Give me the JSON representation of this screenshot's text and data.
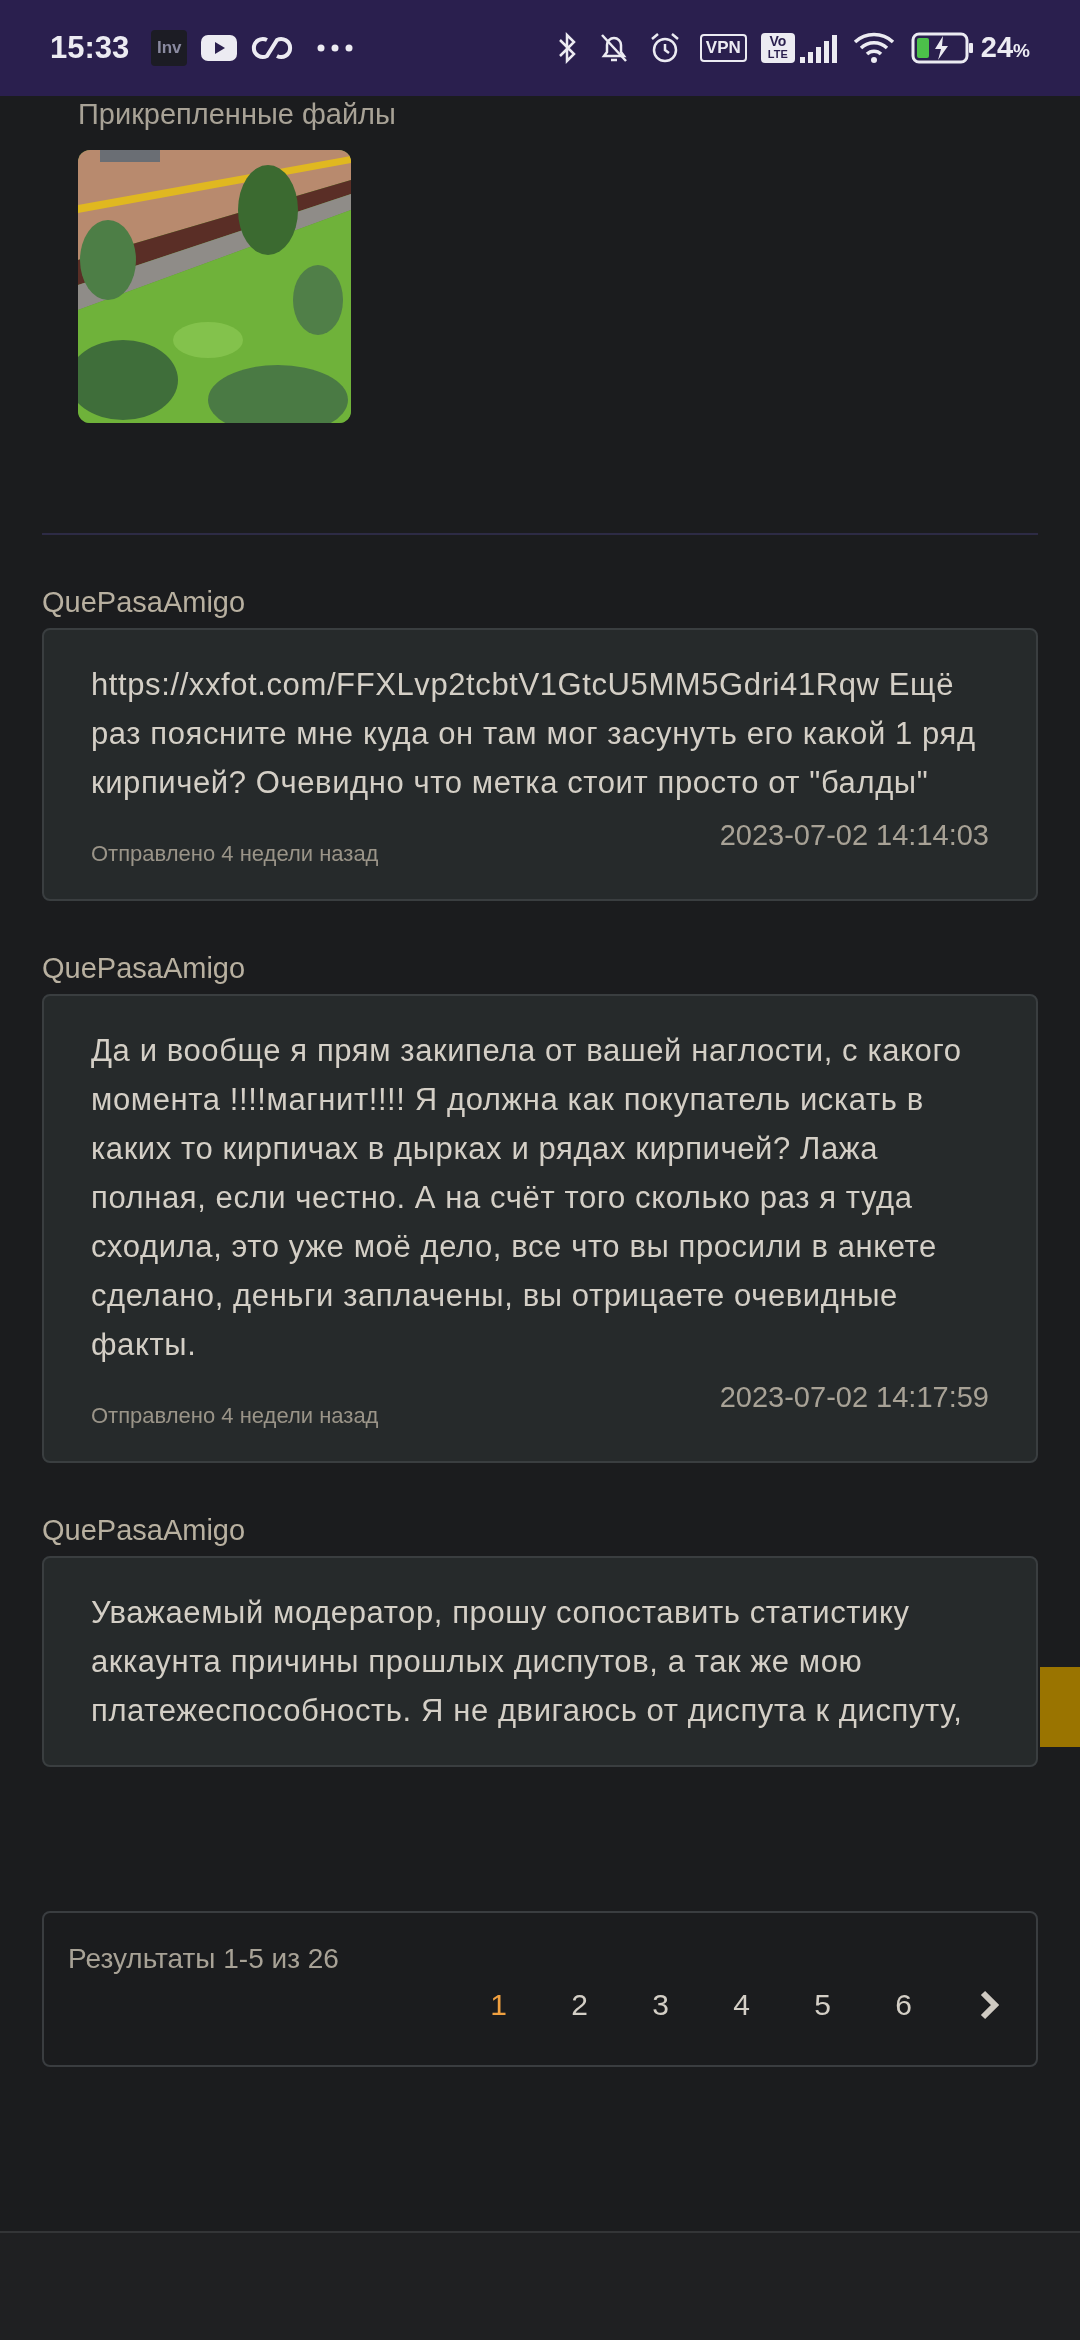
{
  "status_bar": {
    "time": "15:33",
    "app_badge": "Inv",
    "vpn": "VPN",
    "volte_top": "Vo",
    "volte_bottom": "LTE",
    "battery": "24",
    "battery_unit": "%"
  },
  "attachments": {
    "title": "Прикрепленные файлы"
  },
  "comments": [
    {
      "author": "QuePasaAmigo",
      "text": "https://xxfot.com/FFXLvp2tcbtV1GtcU5MM5Gdri41Rqw Ещё раз поясните мне куда он там мог засунуть его какой 1 ряд кирпичей? Очевидно что метка стоит просто от \"балды\"",
      "sent": "Отправлено 4 недели назад",
      "timestamp": "2023-07-02 14:14:03"
    },
    {
      "author": "QuePasaAmigo",
      "text": "Да и вообще я прям закипела от вашей наглости, с какого момента !!!!магнит!!!! Я должна как покупатель искать в каких то кирпичах в дырках и рядах кирпичей? Лажа полная, если честно. А на счёт того сколько раз я туда сходила, это уже моё дело, все что вы просили в анкете сделано, деньги заплачены, вы отрицаете очевидные факты.",
      "sent": "Отправлено 4 недели назад",
      "timestamp": "2023-07-02 14:17:59"
    },
    {
      "author": "QuePasaAmigo",
      "text": "Уважаемый модератор, прошу сопоставить статистику аккаунта причины прошлых диспутов, а так же мою платежеспособность. Я не двигаюсь от диспута к диспуту,"
    }
  ],
  "pagination": {
    "summary": "Результаты 1-5 из 26",
    "pages": [
      {
        "label": "1",
        "selected": true
      },
      {
        "label": "2",
        "selected": false
      },
      {
        "label": "3",
        "selected": false
      },
      {
        "label": "4",
        "selected": false
      },
      {
        "label": "5",
        "selected": false
      },
      {
        "label": "6",
        "selected": false
      }
    ]
  }
}
